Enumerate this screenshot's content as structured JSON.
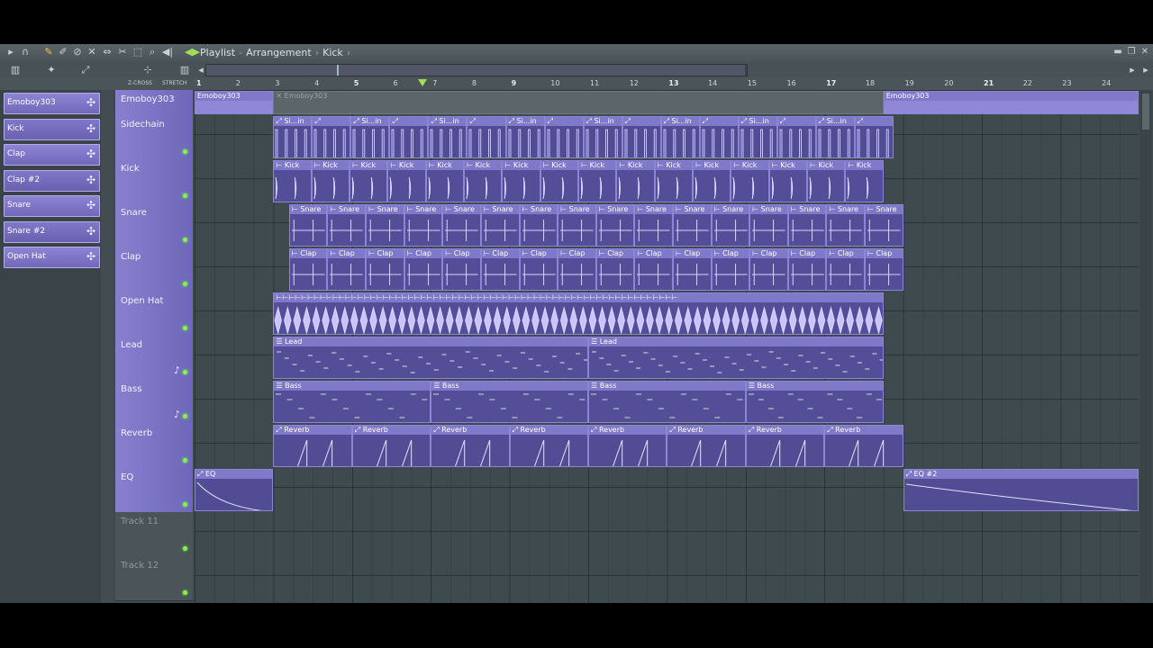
{
  "window": {
    "title_parts": [
      "Playlist",
      "Arrangement",
      "Kick"
    ],
    "title_sep": "›"
  },
  "toolbar": {
    "icons": [
      "play-arrow-icon",
      "magnet-icon",
      "pencil-icon",
      "paint-icon",
      "delete-icon",
      "mute-icon",
      "slip-icon",
      "slice-icon",
      "select-icon",
      "zoom-icon",
      "playback-icon"
    ],
    "xcross_label": "Z-CROSS",
    "stretch_label": "STRETCH"
  },
  "ruler": {
    "bars": [
      "1",
      "2",
      "3",
      "4",
      "5",
      "6",
      "7",
      "8",
      "9",
      "10",
      "11",
      "12",
      "13",
      "14",
      "15",
      "16",
      "17",
      "18",
      "19",
      "20",
      "21",
      "22",
      "23",
      "24"
    ],
    "major_bars": [
      "1",
      "5",
      "9",
      "13",
      "17",
      "21"
    ]
  },
  "picker": {
    "items": [
      {
        "label": "Emoboy303"
      },
      {
        "label": "Kick"
      },
      {
        "label": "Clap"
      },
      {
        "label": "Clap #2"
      },
      {
        "label": "Snare"
      },
      {
        "label": "Snare #2"
      },
      {
        "label": "Open Hat"
      }
    ]
  },
  "tracks": [
    {
      "name": "Emoboy303",
      "active": true
    },
    {
      "name": "Sidechain",
      "active": true
    },
    {
      "name": "Kick",
      "active": true
    },
    {
      "name": "Snare",
      "active": true
    },
    {
      "name": "Clap",
      "active": true
    },
    {
      "name": "Open Hat",
      "active": true
    },
    {
      "name": "Lead",
      "active": true,
      "note": true
    },
    {
      "name": "Bass",
      "active": true,
      "note": true
    },
    {
      "name": "Reverb",
      "active": true
    },
    {
      "name": "EQ",
      "active": true
    },
    {
      "name": "Track 11",
      "active": false
    },
    {
      "name": "Track 12",
      "active": false
    }
  ],
  "clips": {
    "emoboy_label": "Emoboy303",
    "sidechain_label": "Si...in",
    "kick_label": "Kick",
    "snare_label": "Snare",
    "clap_label": "Clap",
    "lead_label": "Lead",
    "bass_label": "Bass",
    "reverb_label": "Reverb",
    "eq_label": "EQ",
    "eq2_label": "EQ #2"
  },
  "colors": {
    "clip_fill": "#514c93",
    "clip_head": "#8078c9",
    "grid_bg": "#3f4a4f",
    "led_green": "#7dff3b",
    "playhead": "#9ee05a"
  }
}
